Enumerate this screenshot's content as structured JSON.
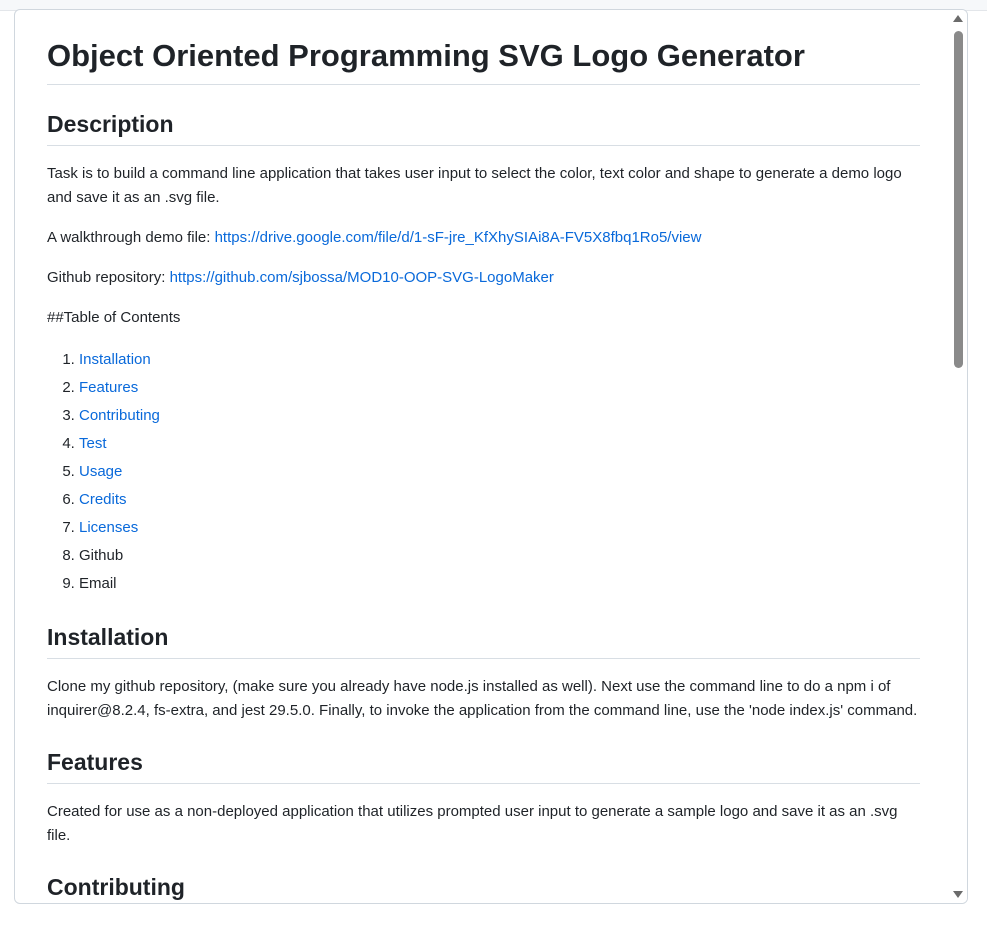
{
  "readme": {
    "title": "Object Oriented Programming SVG Logo Generator",
    "description_heading": "Description",
    "description_text": "Task is to build a command line application that takes user input to select the color, text color and shape to generate a demo logo and save it as an .svg file.",
    "walkthrough_label": "A walkthrough demo file: ",
    "walkthrough_link": "https://drive.google.com/file/d/1-sF-jre_KfXhySIAi8A-FV5X8fbq1Ro5/view",
    "repo_label": "Github repository: ",
    "repo_link": "https://github.com/sjbossa/MOD10-OOP-SVG-LogoMaker",
    "toc_heading": "##Table of Contents",
    "toc_items": [
      {
        "label": "Installation",
        "link": true
      },
      {
        "label": "Features",
        "link": true
      },
      {
        "label": "Contributing",
        "link": true
      },
      {
        "label": "Test",
        "link": true
      },
      {
        "label": "Usage",
        "link": true
      },
      {
        "label": "Credits",
        "link": true
      },
      {
        "label": "Licenses",
        "link": true
      },
      {
        "label": "Github",
        "link": false
      },
      {
        "label": "Email",
        "link": false
      }
    ],
    "installation_heading": "Installation",
    "installation_text": "Clone my github repository, (make sure you already have node.js installed as well). Next use the command line to do a npm i of inquirer@8.2.4, fs-extra, and jest 29.5.0. Finally, to invoke the application from the command line, use the 'node index.js' command.",
    "features_heading": "Features",
    "features_text": "Created for use as a non-deployed application that utilizes prompted user input to generate a sample logo and save it as an .svg file.",
    "next_heading": "Contributing"
  }
}
